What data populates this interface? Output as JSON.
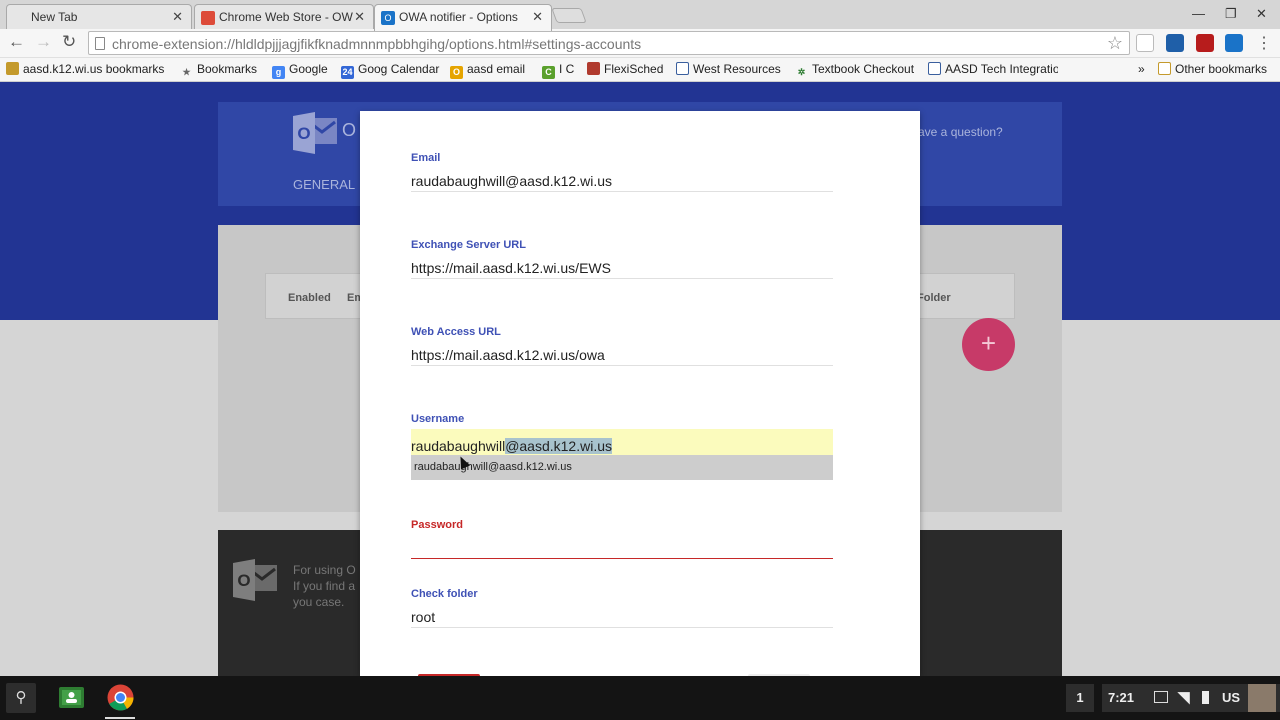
{
  "browser": {
    "tabs": [
      {
        "title": "New Tab",
        "active": false
      },
      {
        "title": "Chrome Web Store - OW",
        "active": false
      },
      {
        "title": "OWA notifier - Options",
        "active": true
      }
    ],
    "url": "chrome-extension://hldldpjjjagjfikfknadmnnmpbbhgihg/options.html#settings-accounts",
    "bookmarks": [
      {
        "label": "aasd.k12.wi.us bookmarks",
        "icon": "folder-icon",
        "color": "#c49a2c"
      },
      {
        "label": "Bookmarks",
        "icon": "star-icon",
        "color": "#666666"
      },
      {
        "label": "Google",
        "icon": "google-icon",
        "color": "#4285f4"
      },
      {
        "label": "Goog Calendar",
        "icon": "calendar-icon",
        "color": "#3367d6"
      },
      {
        "label": "aasd email",
        "icon": "email-icon",
        "color": "#e5a400"
      },
      {
        "label": "I C",
        "icon": "ic-icon",
        "color": "#5aa02c"
      },
      {
        "label": "FlexiSched",
        "icon": "flexisched-icon",
        "color": "#b03a2e"
      },
      {
        "label": "West Resources",
        "icon": "page-icon",
        "color": "#3a5f9e"
      },
      {
        "label": "Textbook Checkout",
        "icon": "gear-icon",
        "color": "#2e7d32"
      },
      {
        "label": "AASD Tech Integratio",
        "icon": "page-icon",
        "color": "#3a5f9e"
      }
    ],
    "overflow": "»",
    "other_bookmarks": "Other bookmarks"
  },
  "app": {
    "logo_letter": "O",
    "brand_partial": "O",
    "nav_general": "GENERAL",
    "question_partial": "ave a question?",
    "table_headers": [
      "Enabled",
      "Em",
      "Folder"
    ],
    "fab_label": "+",
    "footer_lines": [
      "For using O",
      "If you find a",
      "you case."
    ]
  },
  "dialog": {
    "fields": {
      "email": {
        "label": "Email",
        "value": "raudabaughwill@aasd.k12.wi.us"
      },
      "exchange": {
        "label": "Exchange Server URL",
        "value": "https://mail.aasd.k12.wi.us/EWS"
      },
      "webaccess": {
        "label": "Web Access URL",
        "value": "https://mail.aasd.k12.wi.us/owa"
      },
      "username": {
        "label": "Username",
        "typed": "raudabaughwill",
        "selected": "@aasd.k12.wi.us"
      },
      "password": {
        "label": "Password",
        "value": ""
      },
      "folder": {
        "label": "Check folder",
        "value": "root"
      }
    },
    "autocomplete_suggestion": "raudabaughwill@aasd.k12.wi.us"
  },
  "shelf": {
    "notification_count": "1",
    "time": "7:21",
    "locale": "US"
  },
  "colors": {
    "primary_blue": "#223493",
    "accent_pink": "#c73a68",
    "label_blue": "#3f51b5",
    "error_red": "#c62828",
    "autofill_yellow": "#fbfbbd"
  }
}
